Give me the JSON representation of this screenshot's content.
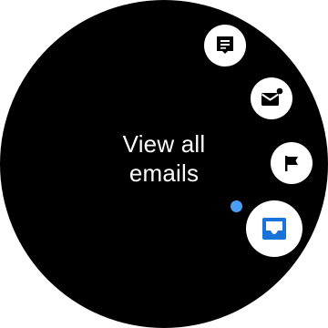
{
  "colors": {
    "background": "#000000",
    "text": "#ffffff",
    "button_bg": "#ffffff",
    "icon_dark": "#000000",
    "accent": "#1a73d9",
    "page_dot": "#4a9ff5"
  },
  "center": {
    "line1": "View all",
    "line2": "emails"
  },
  "actions": [
    {
      "icon": "message-icon"
    },
    {
      "icon": "unread-mail-icon"
    },
    {
      "icon": "flag-icon"
    },
    {
      "icon": "inbox-icon",
      "selected": true
    }
  ]
}
